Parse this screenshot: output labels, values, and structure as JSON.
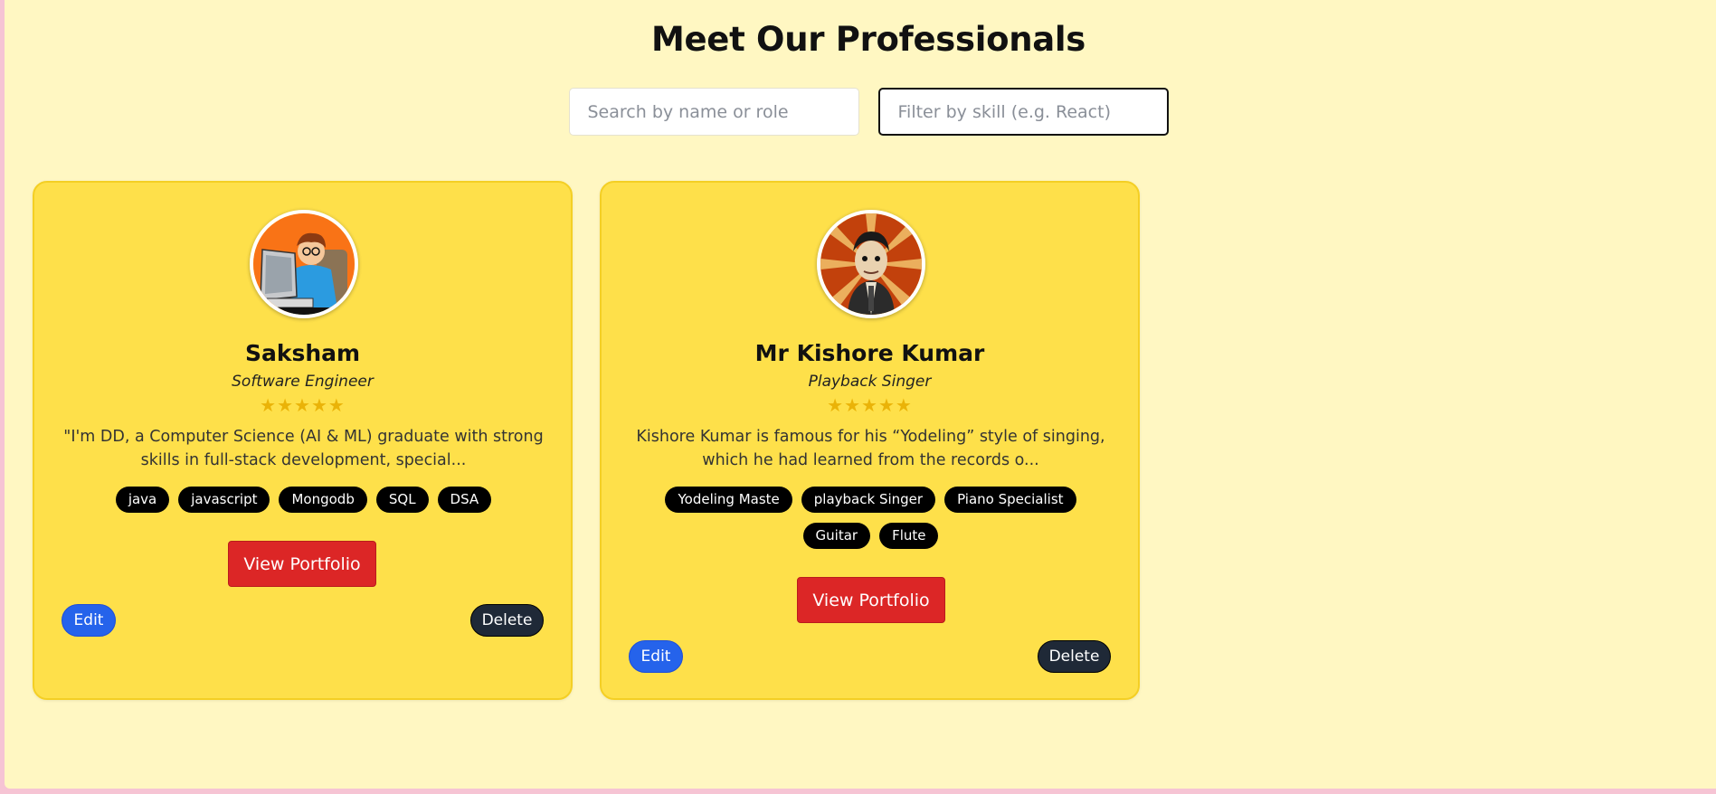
{
  "header": {
    "title": "Meet Our Professionals"
  },
  "search": {
    "placeholder": "Search by name or role",
    "value": ""
  },
  "filter": {
    "placeholder": "Filter by skill (e.g. React)",
    "value": ""
  },
  "colors": {
    "page_bg": "#fff7c2",
    "card_bg": "#fee04a",
    "star": "#eab308",
    "portfolio_button": "#dc2626",
    "edit_button": "#2563eb",
    "delete_button": "#1f2937",
    "skill_chip": "#000000"
  },
  "cards": [
    {
      "name": "Saksham",
      "role": "Software Engineer",
      "rating": "★★★★★",
      "bio": "\"I'm DD, a Computer Science (AI & ML) graduate with strong skills in full-stack development, special...",
      "skills": [
        "java",
        "javascript",
        "Mongodb",
        "SQL",
        "DSA"
      ],
      "portfolio_label": "View Portfolio",
      "edit_label": "Edit",
      "delete_label": "Delete",
      "avatar_icon": "developer-cartoon-avatar"
    },
    {
      "name": "Mr Kishore Kumar",
      "role": "Playback Singer",
      "rating": "★★★★★",
      "bio": "Kishore Kumar is famous for his “Yodeling” style of singing, which he had learned from the records o...",
      "skills": [
        "Yodeling Maste",
        "playback Singer",
        "Piano Specialist",
        "Guitar",
        "Flute"
      ],
      "portfolio_label": "View Portfolio",
      "edit_label": "Edit",
      "delete_label": "Delete",
      "avatar_icon": "singer-portrait-avatar"
    }
  ]
}
